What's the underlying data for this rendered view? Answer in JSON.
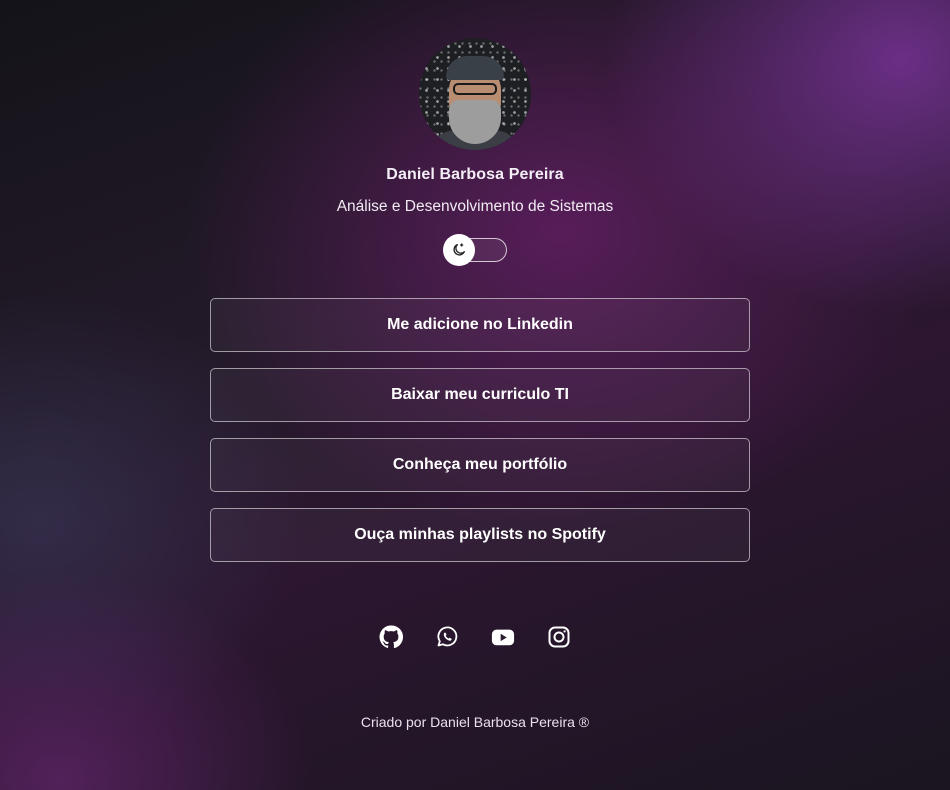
{
  "profile": {
    "name": "Daniel Barbosa Pereira",
    "subtitle": "Análise e Desenvolvimento de Sistemas",
    "avatar_alt": "avatar",
    "theme_toggle_icon": "moon-icon"
  },
  "links": [
    {
      "label": "Me adicione no Linkedin"
    },
    {
      "label": "Baixar meu curriculo TI"
    },
    {
      "label": "Conheça meu portfólio"
    },
    {
      "label": "Ouça minhas playlists no Spotify"
    }
  ],
  "socials": [
    {
      "icon": "github-icon"
    },
    {
      "icon": "whatsapp-icon"
    },
    {
      "icon": "youtube-icon"
    },
    {
      "icon": "instagram-icon"
    }
  ],
  "footer": {
    "text": "Criado por Daniel Barbosa Pereira ®"
  },
  "colors": {
    "accent_purple": "#6b2a78",
    "background_dark": "#1c1422",
    "text": "#ffffff"
  }
}
